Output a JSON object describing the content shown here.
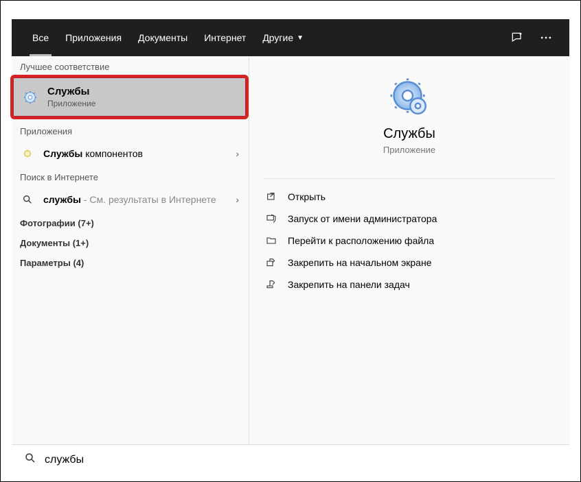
{
  "tabs": {
    "all": "Все",
    "apps": "Приложения",
    "docs": "Документы",
    "internet": "Интернет",
    "more": "Другие"
  },
  "left": {
    "best_label": "Лучшее соответствие",
    "best": {
      "title": "Службы",
      "subtitle": "Приложение"
    },
    "apps_label": "Приложения",
    "apps_row": {
      "bold": "Службы",
      "rest": " компонентов"
    },
    "web_label": "Поиск в Интернете",
    "web_row": {
      "bold": "службы",
      "rest": " - См. результаты в Интернете"
    },
    "photos": "Фотографии (7+)",
    "docs": "Документы (1+)",
    "params": "Параметры (4)"
  },
  "preview": {
    "title": "Службы",
    "subtitle": "Приложение",
    "actions": {
      "open": "Открыть",
      "admin": "Запуск от имени администратора",
      "location": "Перейти к расположению файла",
      "pin_start": "Закрепить на начальном экране",
      "pin_task": "Закрепить на панели задач"
    }
  },
  "search": {
    "value": "службы"
  }
}
